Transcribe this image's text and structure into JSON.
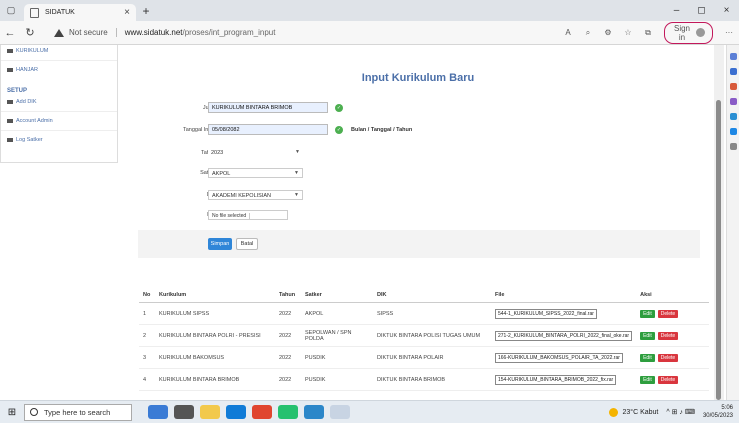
{
  "browser": {
    "tab_title": "SIDATUK",
    "url_security": "Not secure",
    "url_host": "www.sidatuk.net",
    "url_path": "/proses/int_program_input",
    "signin_label": "Sign in"
  },
  "sidebar": {
    "items_top": [
      "KURIKULUM",
      "HANJAR"
    ],
    "setup_heading": "SETUP",
    "items_setup": [
      "Add DIK",
      "Account Admin",
      "Log Satker"
    ]
  },
  "form": {
    "title": "Input Kurikulum Baru",
    "judul_label": "Judul",
    "judul_value": "KURIKULUM BINTARA BRIMOB",
    "tanggal_label": "Tanggal Input",
    "tanggal_value": "05/08/2082",
    "tanggal_hint": "Bulan / Tanggal / Tahun",
    "tahun_label": "Tahun",
    "tahun_value": "2023",
    "satker_label": "Satker",
    "satker_value": "AKPOL",
    "dik_label": "DIK",
    "dik_value": "AKADEMI KEPOLISIAN",
    "file_label": "File",
    "file_value": "No file selected",
    "simpan_label": "Simpan",
    "batal_label": "Batal"
  },
  "table": {
    "headers": [
      "No",
      "Kurikulum",
      "Tahun",
      "Satker",
      "DIK",
      "File",
      "Aksi"
    ],
    "rows": [
      {
        "no": "1",
        "kurikulum": "KURIKULUM SIPSS",
        "tahun": "2022",
        "satker": "AKPOL",
        "dik": "SIPSS",
        "file": "544-1_KURIKULUM_SIPSS_2022_final.rar"
      },
      {
        "no": "2",
        "kurikulum": "KURIKULUM BINTARA POLRI - PRESISI",
        "tahun": "2022",
        "satker": "SEPOLWAN / SPN POLDA",
        "dik": "DIKTUK BINTARA POLISI TUGAS UMUM",
        "file": "271-2_KURIKULUM_BINTARA_POLRI_2022_final_oke.rar"
      },
      {
        "no": "3",
        "kurikulum": "KURIKULUM BAKOMSUS",
        "tahun": "2022",
        "satker": "PUSDIK",
        "dik": "DIKTUK BINTARA POLAIR",
        "file": "166-KURIKULUM_BAKOMSUS_POLAIR_TA_2022.rar"
      },
      {
        "no": "4",
        "kurikulum": "KURIKULUM BINTARA BRIMOB",
        "tahun": "2022",
        "satker": "PUSDIK",
        "dik": "DIKTUK BINTARA BRIMOB",
        "file": "154-KURIKULUM_BINTARA_BRIMOB_2022_fix.rar"
      }
    ],
    "edit_label": "Edit",
    "delete_label": "Delete"
  },
  "taskbar": {
    "search_placeholder": "Type here to search",
    "weather": "23°C Kabut",
    "time": "5:06",
    "date": "30/05/2023"
  }
}
